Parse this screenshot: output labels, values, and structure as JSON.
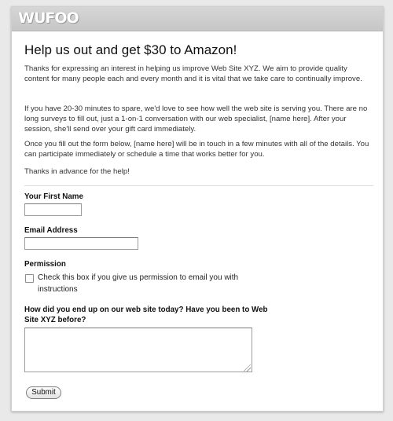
{
  "header": {
    "logo_text": "WUFOO"
  },
  "form": {
    "title": "Help us out and get $30 to Amazon!",
    "paragraphs": [
      "Thanks for expressing an interest in helping us improve Web Site XYZ. We aim to provide quality content for many people each and every month and it is vital that we take care to continually improve.",
      "If you have 20-30 minutes to spare, we'd love to see how well the web site is serving you. There are no long surveys to fill out, just a 1-on-1 conversation with our web specialist, [name here]. After your session, she'll send over your gift card immediately.",
      "Once you fill out the form below, [name here] will be in touch in a few minutes with all of the details. You can participate immediately or schedule a time that works better for you.",
      "Thanks in advance for the help!"
    ],
    "fields": {
      "first_name": {
        "label": "Your First Name",
        "value": ""
      },
      "email": {
        "label": "Email Address",
        "value": ""
      },
      "permission": {
        "label": "Permission",
        "checkbox_text": "Check this box if you give us permission to email you with instructions",
        "checked": false
      },
      "source": {
        "label": "How did you end up on our web site today? Have you been to Web Site XYZ before?",
        "value": ""
      }
    },
    "submit_label": "Submit"
  }
}
